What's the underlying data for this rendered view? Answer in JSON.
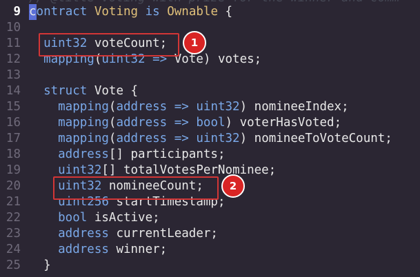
{
  "editor": {
    "cutoff_text": "// @title Voting with prize for the winner and comm",
    "active_line": "9",
    "lines": [
      {
        "num": "9",
        "parts": [
          {
            "t": "c",
            "c": "cursor"
          },
          {
            "t": "ontract",
            "c": "kw"
          },
          {
            "t": " Voting ",
            "c": "ty"
          },
          {
            "t": "is",
            "c": "kw"
          },
          {
            "t": " Ownable ",
            "c": "ty"
          },
          {
            "t": "{",
            "c": "id"
          }
        ]
      },
      {
        "num": "10",
        "parts": []
      },
      {
        "num": "11",
        "parts": [
          {
            "t": "  uint32",
            "c": "kw"
          },
          {
            "t": " voteCount;",
            "c": "id"
          }
        ]
      },
      {
        "num": "12",
        "parts": [
          {
            "t": "  mapping",
            "c": "kw"
          },
          {
            "t": "(",
            "c": "id"
          },
          {
            "t": "uint32",
            "c": "kw"
          },
          {
            "t": " => ",
            "c": "kw"
          },
          {
            "t": "Vote) votes;",
            "c": "id"
          }
        ]
      },
      {
        "num": "13",
        "parts": []
      },
      {
        "num": "14",
        "parts": [
          {
            "t": "  struct",
            "c": "kw"
          },
          {
            "t": " Vote {",
            "c": "id"
          }
        ]
      },
      {
        "num": "15",
        "parts": [
          {
            "t": "    mapping",
            "c": "kw"
          },
          {
            "t": "(",
            "c": "id"
          },
          {
            "t": "address",
            "c": "kw"
          },
          {
            "t": " => ",
            "c": "kw"
          },
          {
            "t": "uint32",
            "c": "kw"
          },
          {
            "t": ") nomineeIndex;",
            "c": "id"
          }
        ]
      },
      {
        "num": "16",
        "parts": [
          {
            "t": "    mapping",
            "c": "kw"
          },
          {
            "t": "(",
            "c": "id"
          },
          {
            "t": "address",
            "c": "kw"
          },
          {
            "t": " => ",
            "c": "kw"
          },
          {
            "t": "bool",
            "c": "kw"
          },
          {
            "t": ") voterHasVoted;",
            "c": "id"
          }
        ]
      },
      {
        "num": "17",
        "parts": [
          {
            "t": "    mapping",
            "c": "kw"
          },
          {
            "t": "(",
            "c": "id"
          },
          {
            "t": "address",
            "c": "kw"
          },
          {
            "t": " => ",
            "c": "kw"
          },
          {
            "t": "uint32",
            "c": "kw"
          },
          {
            "t": ") nomineeToVoteCount;",
            "c": "id"
          }
        ]
      },
      {
        "num": "18",
        "parts": [
          {
            "t": "    address",
            "c": "kw"
          },
          {
            "t": "[] participants;",
            "c": "id"
          }
        ]
      },
      {
        "num": "19",
        "parts": [
          {
            "t": "    uint32",
            "c": "kw"
          },
          {
            "t": "[] totalVotesPerNominee;",
            "c": "id"
          }
        ]
      },
      {
        "num": "20",
        "parts": [
          {
            "t": "    uint32",
            "c": "kw"
          },
          {
            "t": " nomineeCount;",
            "c": "id"
          }
        ]
      },
      {
        "num": "21",
        "parts": [
          {
            "t": "    uint256",
            "c": "kw"
          },
          {
            "t": " startTimestamp;",
            "c": "id"
          }
        ]
      },
      {
        "num": "22",
        "parts": [
          {
            "t": "    bool",
            "c": "kw"
          },
          {
            "t": " isActive;",
            "c": "id"
          }
        ]
      },
      {
        "num": "23",
        "parts": [
          {
            "t": "    address",
            "c": "kw"
          },
          {
            "t": " currentLeader;",
            "c": "id"
          }
        ]
      },
      {
        "num": "24",
        "parts": [
          {
            "t": "    address",
            "c": "kw"
          },
          {
            "t": " winner;",
            "c": "id"
          }
        ]
      },
      {
        "num": "25",
        "parts": [
          {
            "t": "  }",
            "c": "id"
          }
        ]
      }
    ]
  },
  "annotations": [
    {
      "label": "1"
    },
    {
      "label": "2"
    }
  ],
  "colors": {
    "background": "#2b2633",
    "keyword": "#7aa8e8",
    "type": "#e0c07a",
    "identifier": "#e8e8e8",
    "line_number": "#6f6a7a",
    "annotation_red": "#d92424"
  }
}
